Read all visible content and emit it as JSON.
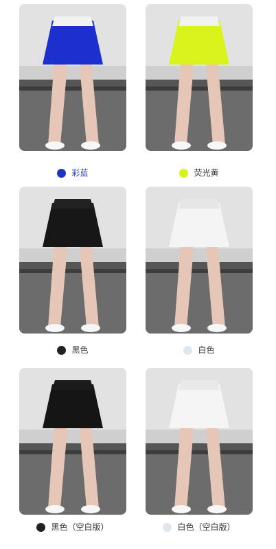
{
  "products": [
    {
      "label": "彩蓝",
      "color": "#1c34c2",
      "label_color": "#2a3fbf",
      "skirt": "#1e2fd0",
      "band": "#f2f2f2",
      "icon": "skirt-photo"
    },
    {
      "label": "荧光黄",
      "color": "#d7f31a",
      "label_color": "#333333",
      "skirt": "#d9f41c",
      "band": "#f2f2f2",
      "icon": "skirt-photo"
    },
    {
      "label": "黑色",
      "color": "#222222",
      "label_color": "#333333",
      "skirt": "#171717",
      "band": "#222222",
      "icon": "skirt-photo"
    },
    {
      "label": "白色",
      "color": "#dfe6ee",
      "label_color": "#333333",
      "skirt": "#f4f4f4",
      "band": "#e6e6e6",
      "icon": "skirt-photo"
    },
    {
      "label": "黑色（空白版）",
      "color": "#222222",
      "label_color": "#333333",
      "skirt": "#151515",
      "band": "#1b1b1b",
      "icon": "skirt-photo"
    },
    {
      "label": "白色（空白版）",
      "color": "#dfe6ee",
      "label_color": "#333333",
      "skirt": "#f5f5f5",
      "band": "#e9e9e9",
      "icon": "skirt-photo"
    }
  ]
}
